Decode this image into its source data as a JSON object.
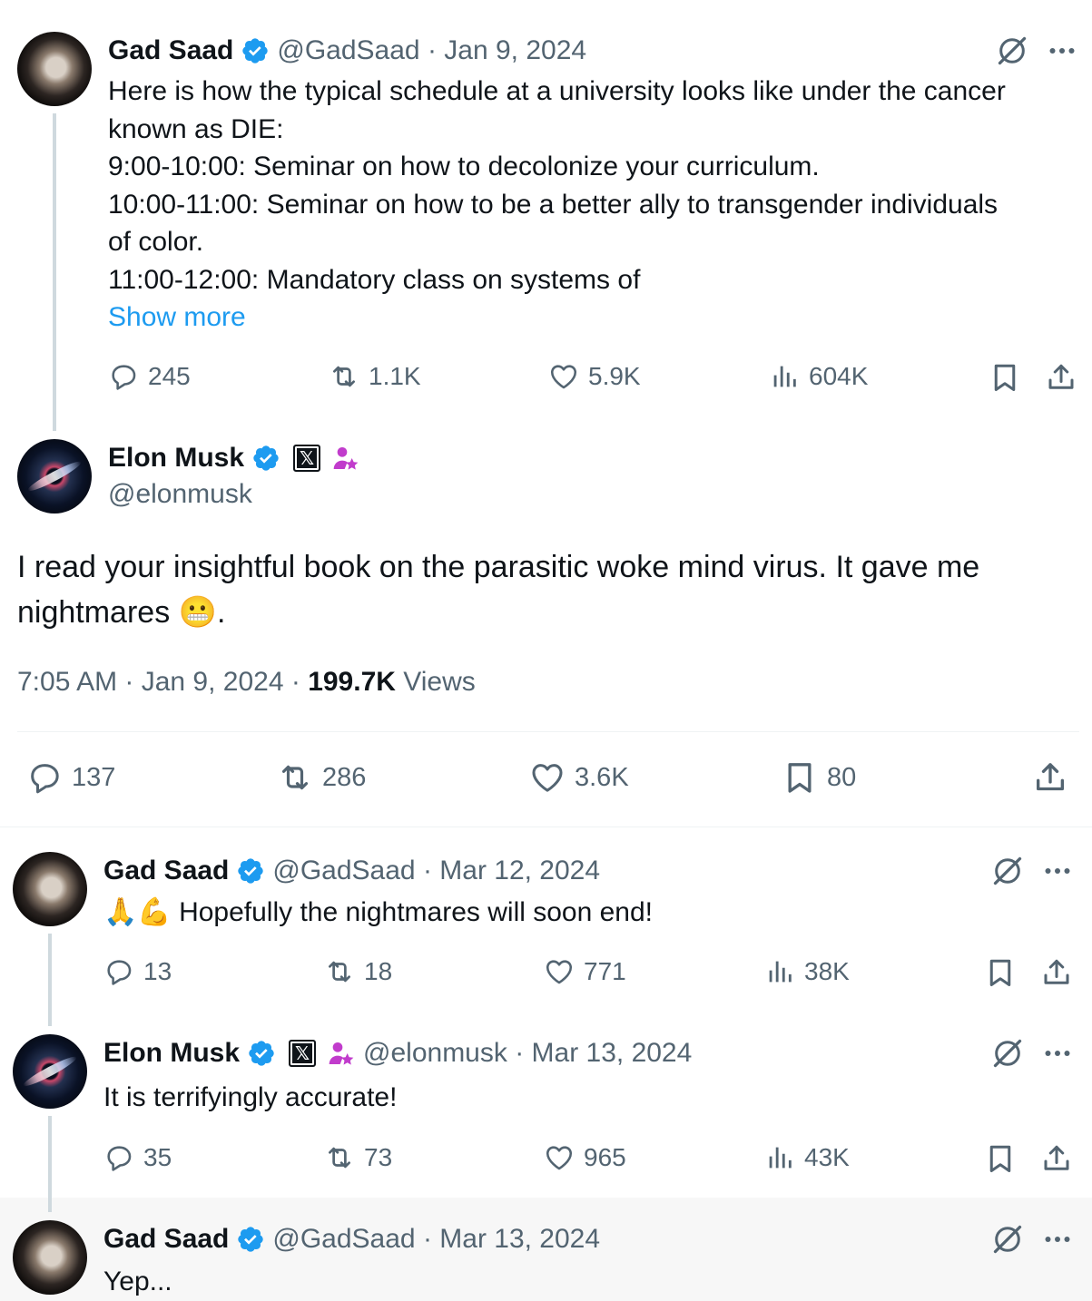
{
  "colors": {
    "accent": "#1d9bf0",
    "secondary_text": "#536471",
    "primary_text": "#0f1419",
    "affiliate_badge": "#c13ccc"
  },
  "tweet1": {
    "name": "Gad Saad",
    "handle_date": "@GadSaad · Jan 9, 2024",
    "lines": [
      "Here is how the typical schedule at a university looks like under the cancer",
      "known as DIE:",
      "9:00-10:00:  Seminar on how to decolonize your curriculum.",
      "10:00-11:00:  Seminar on how to be a better ally to transgender individuals",
      "of color.",
      "11:00-12:00: Mandatory class on systems of"
    ],
    "show_more": "Show more",
    "replies": "245",
    "reposts": "1.1K",
    "likes": "5.9K",
    "views": "604K"
  },
  "main": {
    "name": "Elon Musk",
    "handle": "@elonmusk",
    "text_line1": "I read your insightful book on the parasitic woke mind virus. It gave me",
    "text_line2": "nightmares",
    "emoji": "😬",
    "text_tail": ".",
    "time": "7:05 AM · Jan 9, 2024 · ",
    "views_count": "199.7K",
    "views_label": " Views",
    "replies": "137",
    "reposts": "286",
    "likes": "3.6K",
    "bookmarks": "80"
  },
  "reply1": {
    "name": "Gad Saad",
    "handle_date": "@GadSaad · Mar 12, 2024",
    "emojis": "🙏💪",
    "text": "Hopefully the nightmares will soon end!",
    "replies": "13",
    "reposts": "18",
    "likes": "771",
    "views": "38K"
  },
  "reply2": {
    "name": "Elon Musk",
    "handle_date": "@elonmusk · Mar 13, 2024",
    "text": "It is terrifyingly accurate!",
    "replies": "35",
    "reposts": "73",
    "likes": "965",
    "views": "43K"
  },
  "reply3": {
    "name": "Gad Saad",
    "handle_date": "@GadSaad · Mar 13, 2024",
    "text": "Yep..."
  },
  "icons": {
    "verified": "verified-badge-icon",
    "x": "x-affiliate-badge-icon",
    "affiliate": "affiliate-person-star-icon",
    "grok": "grok-icon",
    "more": "more-dots-icon",
    "reply": "reply-icon",
    "repost": "repost-icon",
    "like": "like-icon",
    "views": "views-icon",
    "bookmark": "bookmark-icon",
    "share": "share-icon"
  }
}
